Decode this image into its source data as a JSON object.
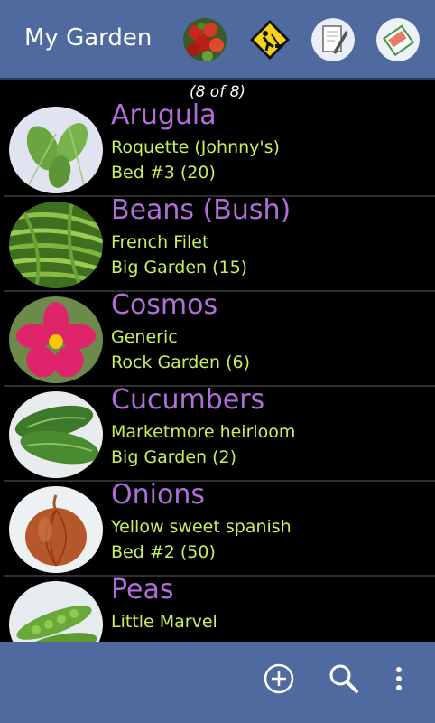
{
  "app": {
    "title": "My Garden"
  },
  "toolbar_icons": [
    "tomatoes-photo-icon",
    "gardener-sign-icon",
    "notes-icon",
    "seeds-packet-icon"
  ],
  "count_label": "(8 of 8)",
  "plants": [
    {
      "name": "Arugula",
      "variety": "Roquette (Johnny's)",
      "location": "Bed #3  (20)",
      "icon": "arugula-photo"
    },
    {
      "name": "Beans (Bush)",
      "variety": "French Filet",
      "location": "Big Garden  (15)",
      "icon": "beans-photo"
    },
    {
      "name": "Cosmos",
      "variety": "Generic",
      "location": "Rock Garden  (6)",
      "icon": "cosmos-photo"
    },
    {
      "name": "Cucumbers",
      "variety": "Marketmore heirloom",
      "location": "Big Garden  (2)",
      "icon": "cucumbers-photo"
    },
    {
      "name": "Onions",
      "variety": "Yellow sweet spanish",
      "location": "Bed #2  (50)",
      "icon": "onion-photo"
    },
    {
      "name": "Peas",
      "variety": "Little Marvel",
      "location": "",
      "icon": "peas-photo"
    }
  ],
  "bottom_actions": [
    "add-icon",
    "search-icon",
    "overflow-menu-icon"
  ],
  "colors": {
    "appbar": "#4f6a9e",
    "plant_name": "#b06ed8",
    "plant_detail": "#c8f05a"
  }
}
